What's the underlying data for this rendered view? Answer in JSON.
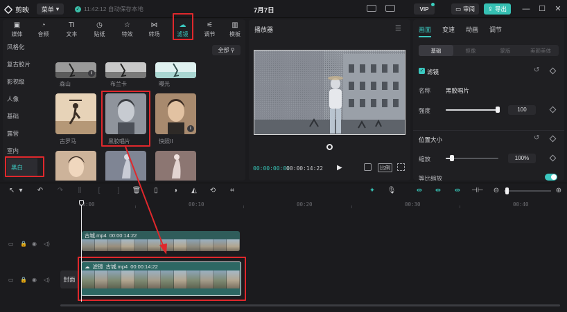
{
  "app": {
    "name": "剪映",
    "menu_label": "菜单",
    "save_status": "11:42:12 自动保存本地",
    "project_title": "7月7日",
    "vip_label": "VIP",
    "review_label": "审阅",
    "export_label": "导出"
  },
  "toolbar_tabs": [
    {
      "label": "媒体",
      "icon": "media-icon"
    },
    {
      "label": "音频",
      "icon": "audio-icon"
    },
    {
      "label": "文本",
      "icon": "text-icon"
    },
    {
      "label": "贴纸",
      "icon": "sticker-icon"
    },
    {
      "label": "特效",
      "icon": "effects-icon"
    },
    {
      "label": "转场",
      "icon": "transition-icon"
    },
    {
      "label": "滤镜",
      "icon": "filter-icon",
      "active": true
    },
    {
      "label": "调节",
      "icon": "adjust-icon"
    },
    {
      "label": "模板",
      "icon": "template-icon"
    }
  ],
  "filter_categories": [
    "风格化",
    "复古胶片",
    "影视级",
    "人像",
    "基础",
    "露营",
    "室内",
    "黑白"
  ],
  "filter_active_category": "黑白",
  "sort_label": "全部",
  "filters": [
    {
      "label": "森山",
      "download": true
    },
    {
      "label": "布兰卡",
      "download": false
    },
    {
      "label": "曝光",
      "download": false
    },
    {
      "label": "古罗马",
      "download": false
    },
    {
      "label": "黑胶唱片",
      "download": false,
      "selected": true
    },
    {
      "label": "快照II",
      "download": true
    },
    {
      "label": "",
      "download": false
    },
    {
      "label": "",
      "download": false
    },
    {
      "label": "",
      "download": false
    }
  ],
  "player": {
    "title": "播放器",
    "time_current": "00:00:00:00",
    "time_total": "00:00:14:22",
    "ratio_label": "比例"
  },
  "inspector": {
    "tabs": [
      "画面",
      "变速",
      "动画",
      "调节"
    ],
    "active_tab": "画面",
    "subtabs": [
      "基础",
      "抠像",
      "蒙版",
      "美颜美体"
    ],
    "active_subtab": "基础",
    "filter_section": "滤镜",
    "name_label": "名称",
    "name_value": "黑胶唱片",
    "strength_label": "强度",
    "strength_value": "100",
    "strength_fraction": 1.0,
    "position_section": "位置大小",
    "scale_label": "缩放",
    "scale_value": "100%",
    "scale_fraction": 0.12,
    "uniform_scale_label": "等比缩放"
  },
  "timeline": {
    "ruler": [
      "00:00",
      "00:10",
      "00:20",
      "00:30",
      "00:40"
    ],
    "cover_label": "封面",
    "clip_top": {
      "name": "古城.mp4",
      "duration": "00:00:14:22"
    },
    "clip_main": {
      "filter_tag": "滤镜",
      "name": "古城.mp4",
      "duration": "00:00:14:22"
    }
  },
  "colors": {
    "accent": "#36c0b3",
    "highlight_annotation": "#e0282c",
    "clip_top_header": "#2f5c5a",
    "clip_main_header": "#2d6763"
  }
}
